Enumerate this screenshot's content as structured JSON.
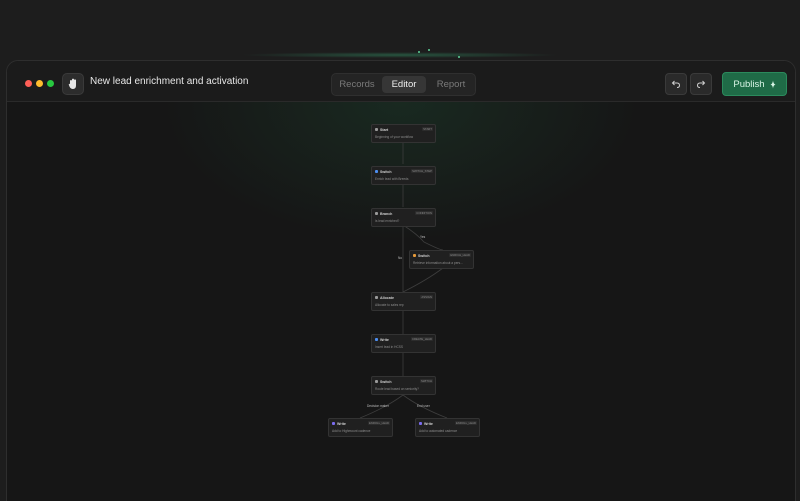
{
  "window": {
    "title": "New lead enrichment and activation"
  },
  "tabs": [
    {
      "label": "Records",
      "active": false
    },
    {
      "label": "Editor",
      "active": true
    },
    {
      "label": "Report",
      "active": false
    }
  ],
  "toolbar": {
    "undo_icon": "undo-icon",
    "redo_icon": "redo-icon",
    "publish_label": "Publish"
  },
  "colors": {
    "accent": "#1f6b47",
    "traffic_red": "#ff5f57",
    "traffic_yellow": "#febc2e",
    "traffic_green": "#28c840"
  },
  "nodes": {
    "start": {
      "title": "Start",
      "badge": "START",
      "desc": "Beginning of your workflow",
      "icon": "play-icon"
    },
    "switch1": {
      "title": "Switch",
      "badge": "SWITCH_STEP",
      "desc": "Enrich lead with Breeds",
      "icon": "switch-icon"
    },
    "branch": {
      "title": "Branch",
      "badge": "CONDITION",
      "desc": "Is lead enriched?",
      "icon": "branch-icon"
    },
    "switch2": {
      "title": "Switch",
      "badge": "ENRICH_LEAD",
      "desc": "Retrieve information about a pers...",
      "icon": "switch-icon"
    },
    "allocate": {
      "title": "Allocate",
      "badge": "ASSIGN",
      "desc": "Allocate to sales rep",
      "icon": "allocate-icon"
    },
    "write1": {
      "title": "Write",
      "badge": "CREATE_LEAD",
      "desc": "Insert lead in HCSS",
      "icon": "write-icon"
    },
    "switch3": {
      "title": "Switch",
      "badge": "SWITCH",
      "desc": "Route lead based on seniority?",
      "icon": "switch-icon"
    },
    "write2": {
      "title": "Write",
      "badge": "ENROLL_LEAD",
      "desc": "Add to Highmount cadence",
      "icon": "write-icon"
    },
    "write3": {
      "title": "Write",
      "badge": "ENROLL_LEAD",
      "desc": "Add to automated cadence",
      "icon": "write-icon"
    }
  },
  "edge_labels": {
    "yes": "Yes",
    "no": "No",
    "decision_maker": "Decision maker",
    "end_user": "End user"
  }
}
